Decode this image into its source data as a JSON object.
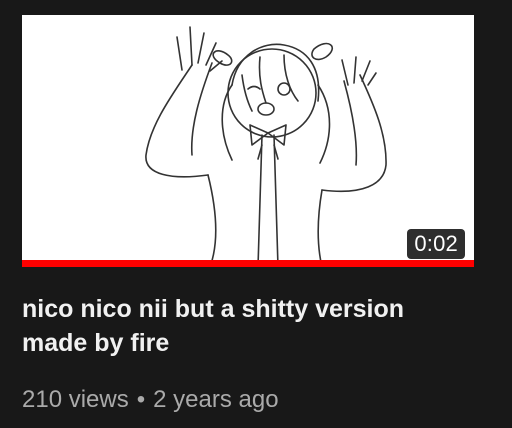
{
  "video": {
    "duration": "0:02",
    "progress_fraction": 1.0,
    "title": "nico nico nii but a shitty version made by fire",
    "views": "210 views",
    "separator": "•",
    "age": "2 years ago"
  },
  "colors": {
    "background": "#181818",
    "progress": "#ff0000",
    "title_text": "#f1f1f1",
    "meta_text": "#aaaaaa"
  }
}
